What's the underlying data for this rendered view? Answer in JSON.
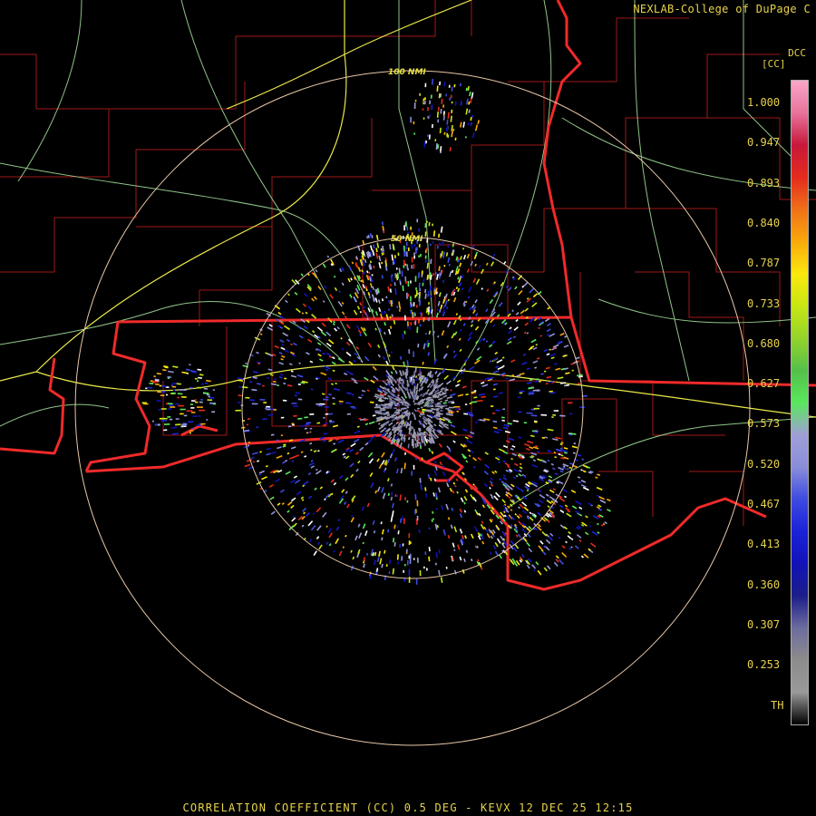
{
  "header": {
    "credit": "NEXLAB-College of DuPage C",
    "source_code": "DCC"
  },
  "legend": {
    "unit": "[CC]",
    "ticks": [
      "1.000",
      "0.947",
      "0.893",
      "0.840",
      "0.787",
      "0.733",
      "0.680",
      "0.627",
      "0.573",
      "0.520",
      "0.467",
      "0.413",
      "0.360",
      "0.307",
      "0.253",
      "TH"
    ],
    "color_stops": [
      {
        "value": "1.000",
        "color": "#f9a6c8"
      },
      {
        "value": "0.970",
        "color": "#e8739c"
      },
      {
        "value": "0.947",
        "color": "#c7183a"
      },
      {
        "value": "0.930",
        "color": "#e52b1d"
      },
      {
        "value": "0.915",
        "color": "#f07018"
      },
      {
        "value": "0.900",
        "color": "#f9aa0b"
      },
      {
        "value": "0.880",
        "color": "#fbe80c"
      },
      {
        "value": "0.860",
        "color": "#c8e614"
      },
      {
        "value": "0.840",
        "color": "#94d42a"
      },
      {
        "value": "0.810",
        "color": "#55c04a"
      },
      {
        "value": "0.787",
        "color": "#59e85c"
      },
      {
        "value": "0.760",
        "color": "#9f9fd7"
      },
      {
        "value": "0.733",
        "color": "#8a8ed8"
      },
      {
        "value": "0.710",
        "color": "#3e4be1"
      },
      {
        "value": "0.660",
        "color": "#1a22d9"
      },
      {
        "value": "0.530",
        "color": "#1212b8"
      },
      {
        "value": "0.450",
        "color": "#1c1d8a"
      },
      {
        "value": "0.413",
        "color": "#6c6ca0"
      },
      {
        "value": "0.390",
        "color": "#8c8c8c"
      },
      {
        "value": "0.200",
        "color": "#9a9a9a"
      },
      {
        "value": "TH",
        "color": "#000000"
      }
    ]
  },
  "map": {
    "range_rings": [
      {
        "label": "50 NMI"
      },
      {
        "label": "100 NMI"
      }
    ],
    "colors": {
      "state_border": "#f02a2a",
      "county_border": "#a01818",
      "highway": "#a8e8a0",
      "interstate": "#e8e84a",
      "ring": "#e8c8a8"
    }
  },
  "footer": {
    "title": "CORRELATION COEFFICIENT (CC) 0.5 DEG - KEVX 12 DEC 25 12:15"
  }
}
